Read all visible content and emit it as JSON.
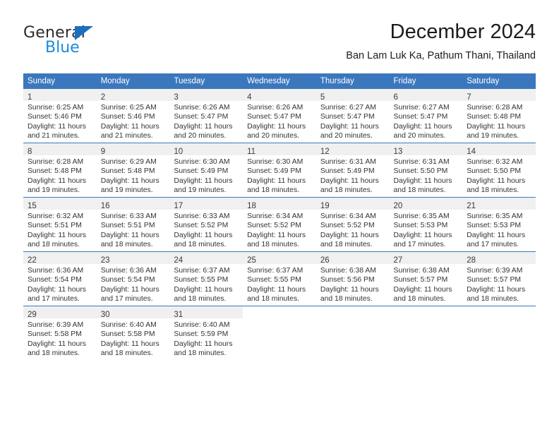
{
  "brand": {
    "name_top": "General",
    "name_bottom": "Blue",
    "triangle_icon": "triangle-icon",
    "accent_blue": "#1b8bdb",
    "logo_dark": "#2b2b2b"
  },
  "header": {
    "title": "December 2024",
    "subtitle": "Ban Lam Luk Ka, Pathum Thani, Thailand"
  },
  "theme": {
    "header_row_bg": "#3b77bd",
    "header_row_text": "#ffffff",
    "daynum_band_bg": "#f0f0f0",
    "row_separator": "#3b77bd",
    "body_text": "#333333"
  },
  "calendar": {
    "weekday_headers": [
      "Sunday",
      "Monday",
      "Tuesday",
      "Wednesday",
      "Thursday",
      "Friday",
      "Saturday"
    ],
    "weeks": [
      [
        {
          "day": "1",
          "sunrise": "Sunrise: 6:25 AM",
          "sunset": "Sunset: 5:46 PM",
          "daylight_1": "Daylight: 11 hours",
          "daylight_2": "and 21 minutes."
        },
        {
          "day": "2",
          "sunrise": "Sunrise: 6:25 AM",
          "sunset": "Sunset: 5:46 PM",
          "daylight_1": "Daylight: 11 hours",
          "daylight_2": "and 21 minutes."
        },
        {
          "day": "3",
          "sunrise": "Sunrise: 6:26 AM",
          "sunset": "Sunset: 5:47 PM",
          "daylight_1": "Daylight: 11 hours",
          "daylight_2": "and 20 minutes."
        },
        {
          "day": "4",
          "sunrise": "Sunrise: 6:26 AM",
          "sunset": "Sunset: 5:47 PM",
          "daylight_1": "Daylight: 11 hours",
          "daylight_2": "and 20 minutes."
        },
        {
          "day": "5",
          "sunrise": "Sunrise: 6:27 AM",
          "sunset": "Sunset: 5:47 PM",
          "daylight_1": "Daylight: 11 hours",
          "daylight_2": "and 20 minutes."
        },
        {
          "day": "6",
          "sunrise": "Sunrise: 6:27 AM",
          "sunset": "Sunset: 5:47 PM",
          "daylight_1": "Daylight: 11 hours",
          "daylight_2": "and 20 minutes."
        },
        {
          "day": "7",
          "sunrise": "Sunrise: 6:28 AM",
          "sunset": "Sunset: 5:48 PM",
          "daylight_1": "Daylight: 11 hours",
          "daylight_2": "and 19 minutes."
        }
      ],
      [
        {
          "day": "8",
          "sunrise": "Sunrise: 6:28 AM",
          "sunset": "Sunset: 5:48 PM",
          "daylight_1": "Daylight: 11 hours",
          "daylight_2": "and 19 minutes."
        },
        {
          "day": "9",
          "sunrise": "Sunrise: 6:29 AM",
          "sunset": "Sunset: 5:48 PM",
          "daylight_1": "Daylight: 11 hours",
          "daylight_2": "and 19 minutes."
        },
        {
          "day": "10",
          "sunrise": "Sunrise: 6:30 AM",
          "sunset": "Sunset: 5:49 PM",
          "daylight_1": "Daylight: 11 hours",
          "daylight_2": "and 19 minutes."
        },
        {
          "day": "11",
          "sunrise": "Sunrise: 6:30 AM",
          "sunset": "Sunset: 5:49 PM",
          "daylight_1": "Daylight: 11 hours",
          "daylight_2": "and 18 minutes."
        },
        {
          "day": "12",
          "sunrise": "Sunrise: 6:31 AM",
          "sunset": "Sunset: 5:49 PM",
          "daylight_1": "Daylight: 11 hours",
          "daylight_2": "and 18 minutes."
        },
        {
          "day": "13",
          "sunrise": "Sunrise: 6:31 AM",
          "sunset": "Sunset: 5:50 PM",
          "daylight_1": "Daylight: 11 hours",
          "daylight_2": "and 18 minutes."
        },
        {
          "day": "14",
          "sunrise": "Sunrise: 6:32 AM",
          "sunset": "Sunset: 5:50 PM",
          "daylight_1": "Daylight: 11 hours",
          "daylight_2": "and 18 minutes."
        }
      ],
      [
        {
          "day": "15",
          "sunrise": "Sunrise: 6:32 AM",
          "sunset": "Sunset: 5:51 PM",
          "daylight_1": "Daylight: 11 hours",
          "daylight_2": "and 18 minutes."
        },
        {
          "day": "16",
          "sunrise": "Sunrise: 6:33 AM",
          "sunset": "Sunset: 5:51 PM",
          "daylight_1": "Daylight: 11 hours",
          "daylight_2": "and 18 minutes."
        },
        {
          "day": "17",
          "sunrise": "Sunrise: 6:33 AM",
          "sunset": "Sunset: 5:52 PM",
          "daylight_1": "Daylight: 11 hours",
          "daylight_2": "and 18 minutes."
        },
        {
          "day": "18",
          "sunrise": "Sunrise: 6:34 AM",
          "sunset": "Sunset: 5:52 PM",
          "daylight_1": "Daylight: 11 hours",
          "daylight_2": "and 18 minutes."
        },
        {
          "day": "19",
          "sunrise": "Sunrise: 6:34 AM",
          "sunset": "Sunset: 5:52 PM",
          "daylight_1": "Daylight: 11 hours",
          "daylight_2": "and 18 minutes."
        },
        {
          "day": "20",
          "sunrise": "Sunrise: 6:35 AM",
          "sunset": "Sunset: 5:53 PM",
          "daylight_1": "Daylight: 11 hours",
          "daylight_2": "and 17 minutes."
        },
        {
          "day": "21",
          "sunrise": "Sunrise: 6:35 AM",
          "sunset": "Sunset: 5:53 PM",
          "daylight_1": "Daylight: 11 hours",
          "daylight_2": "and 17 minutes."
        }
      ],
      [
        {
          "day": "22",
          "sunrise": "Sunrise: 6:36 AM",
          "sunset": "Sunset: 5:54 PM",
          "daylight_1": "Daylight: 11 hours",
          "daylight_2": "and 17 minutes."
        },
        {
          "day": "23",
          "sunrise": "Sunrise: 6:36 AM",
          "sunset": "Sunset: 5:54 PM",
          "daylight_1": "Daylight: 11 hours",
          "daylight_2": "and 17 minutes."
        },
        {
          "day": "24",
          "sunrise": "Sunrise: 6:37 AM",
          "sunset": "Sunset: 5:55 PM",
          "daylight_1": "Daylight: 11 hours",
          "daylight_2": "and 18 minutes."
        },
        {
          "day": "25",
          "sunrise": "Sunrise: 6:37 AM",
          "sunset": "Sunset: 5:55 PM",
          "daylight_1": "Daylight: 11 hours",
          "daylight_2": "and 18 minutes."
        },
        {
          "day": "26",
          "sunrise": "Sunrise: 6:38 AM",
          "sunset": "Sunset: 5:56 PM",
          "daylight_1": "Daylight: 11 hours",
          "daylight_2": "and 18 minutes."
        },
        {
          "day": "27",
          "sunrise": "Sunrise: 6:38 AM",
          "sunset": "Sunset: 5:57 PM",
          "daylight_1": "Daylight: 11 hours",
          "daylight_2": "and 18 minutes."
        },
        {
          "day": "28",
          "sunrise": "Sunrise: 6:39 AM",
          "sunset": "Sunset: 5:57 PM",
          "daylight_1": "Daylight: 11 hours",
          "daylight_2": "and 18 minutes."
        }
      ],
      [
        {
          "day": "29",
          "sunrise": "Sunrise: 6:39 AM",
          "sunset": "Sunset: 5:58 PM",
          "daylight_1": "Daylight: 11 hours",
          "daylight_2": "and 18 minutes."
        },
        {
          "day": "30",
          "sunrise": "Sunrise: 6:40 AM",
          "sunset": "Sunset: 5:58 PM",
          "daylight_1": "Daylight: 11 hours",
          "daylight_2": "and 18 minutes."
        },
        {
          "day": "31",
          "sunrise": "Sunrise: 6:40 AM",
          "sunset": "Sunset: 5:59 PM",
          "daylight_1": "Daylight: 11 hours",
          "daylight_2": "and 18 minutes."
        },
        {
          "day": "",
          "sunrise": "",
          "sunset": "",
          "daylight_1": "",
          "daylight_2": ""
        },
        {
          "day": "",
          "sunrise": "",
          "sunset": "",
          "daylight_1": "",
          "daylight_2": ""
        },
        {
          "day": "",
          "sunrise": "",
          "sunset": "",
          "daylight_1": "",
          "daylight_2": ""
        },
        {
          "day": "",
          "sunrise": "",
          "sunset": "",
          "daylight_1": "",
          "daylight_2": ""
        }
      ]
    ]
  }
}
